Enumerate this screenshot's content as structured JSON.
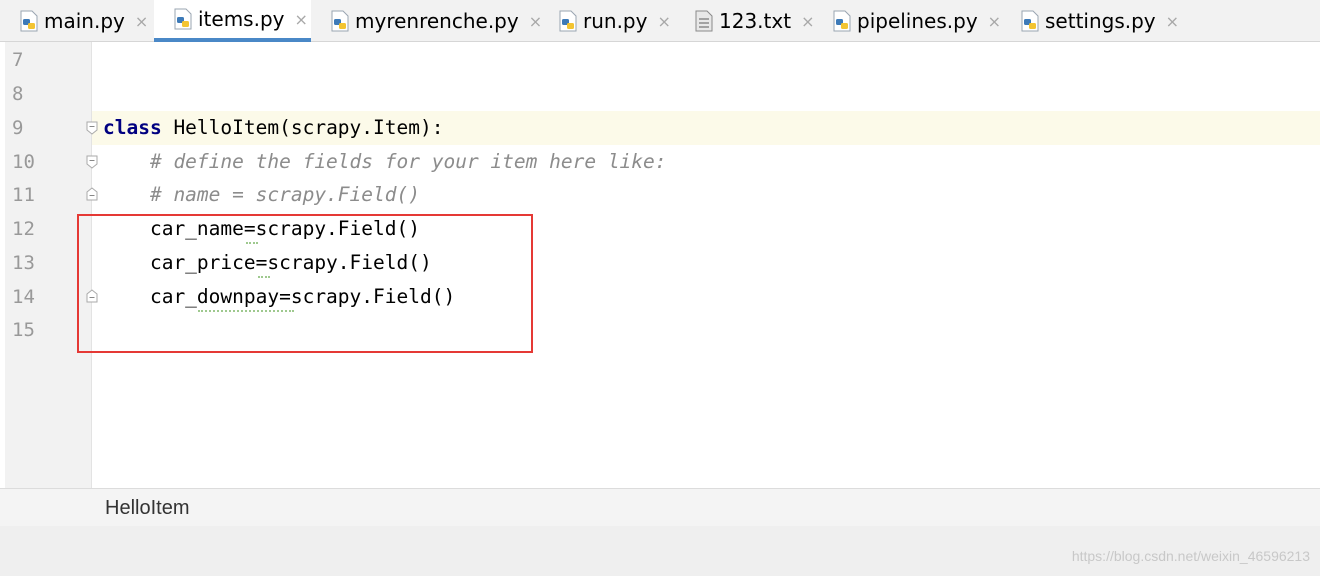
{
  "tabs": [
    {
      "label": "main.py",
      "icon": "python-file-icon"
    },
    {
      "label": "items.py",
      "icon": "python-file-icon",
      "active": true
    },
    {
      "label": "myrenrenche.py",
      "icon": "python-file-icon"
    },
    {
      "label": "run.py",
      "icon": "python-file-icon"
    },
    {
      "label": "123.txt",
      "icon": "text-file-icon"
    },
    {
      "label": "pipelines.py",
      "icon": "python-file-icon"
    },
    {
      "label": "settings.py",
      "icon": "python-file-icon"
    }
  ],
  "close_glyph": "×",
  "line_numbers": [
    "7",
    "8",
    "9",
    "10",
    "11",
    "12",
    "13",
    "14",
    "15"
  ],
  "code": {
    "line9_kw": "class",
    "line9_rest": " HelloItem(scrapy.Item):",
    "line10": "    # define the fields for your item here like:",
    "line11": "    # name = scrapy.Field()",
    "line12": "    car_name=scrapy.Field()",
    "line13": "    car_price=scrapy.Field()",
    "line14": "    car_downpay=scrapy.Field()"
  },
  "breadcrumb": "HelloItem",
  "watermark": "https://blog.csdn.net/weixin_46596213",
  "colors": {
    "tab_active_underline": "#4a88c7",
    "highlight_box": "#e53935",
    "keyword": "#000080",
    "comment": "#8c8c8c",
    "current_line": "#fcfae9"
  }
}
